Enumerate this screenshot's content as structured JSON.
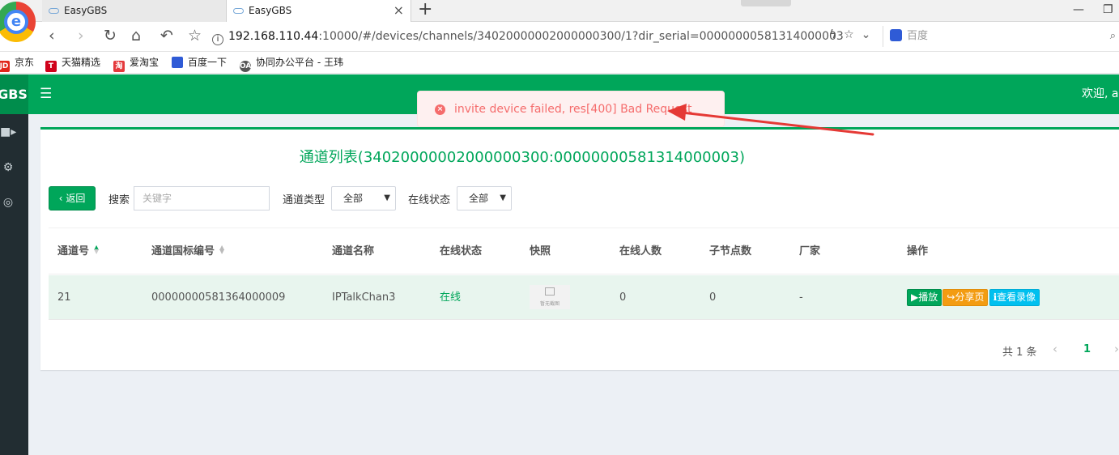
{
  "browser": {
    "tabs": [
      {
        "label": "EasyGBS"
      },
      {
        "label": "EasyGBS"
      }
    ],
    "new_tab": "+",
    "address": {
      "host": "192.168.110.44",
      "path": ":10000/#/devices/channels/34020000002000000300/1?dir_serial=00000000581314000003"
    },
    "search_placeholder": "百度",
    "bookmarks": [
      {
        "label": "京东",
        "badge": "JD",
        "color": "#e1251b"
      },
      {
        "label": "天猫精选",
        "badge": "T",
        "color": "#d0021b"
      },
      {
        "label": "爱淘宝",
        "badge": "淘",
        "color": "#e4393c"
      },
      {
        "label": "百度一下",
        "badge": "",
        "color": "#2f5bd6"
      },
      {
        "label": "协同办公平台 - 王玮",
        "badge": "OA",
        "color": "#555555"
      }
    ]
  },
  "app": {
    "logo": "GBS",
    "welcome": "欢迎, ad",
    "toast": "invite device failed, res[400] Bad Request",
    "title": "通道列表(34020000002000000300:00000000581314000003)",
    "filters": {
      "back": "返回",
      "search_label": "搜索",
      "search_placeholder": "关键字",
      "channel_type_label": "通道类型",
      "channel_type_value": "全部",
      "online_status_label": "在线状态",
      "online_status_value": "全部"
    },
    "columns": [
      "通道号",
      "通道国标编号",
      "通道名称",
      "在线状态",
      "快照",
      "在线人数",
      "子节点数",
      "厂家",
      "操作"
    ],
    "rows": [
      {
        "channel_no": "21",
        "gb_id": "00000000581364000009",
        "name": "IPTalkChan3",
        "status": "在线",
        "snapshot_caption": "暂无截图",
        "viewers": "0",
        "children": "0",
        "vendor": "-",
        "actions": {
          "play": "播放",
          "share": "分享页",
          "record": "查看录像"
        }
      }
    ],
    "pagination": {
      "total": "共 1 条",
      "current": "1"
    }
  },
  "colors": {
    "primary": "#00a65a",
    "sidebar": "#222d32",
    "warning": "#f39c12",
    "info": "#00c0ef",
    "error": "#f56c6c",
    "annotation_arrow": "#e53935"
  }
}
